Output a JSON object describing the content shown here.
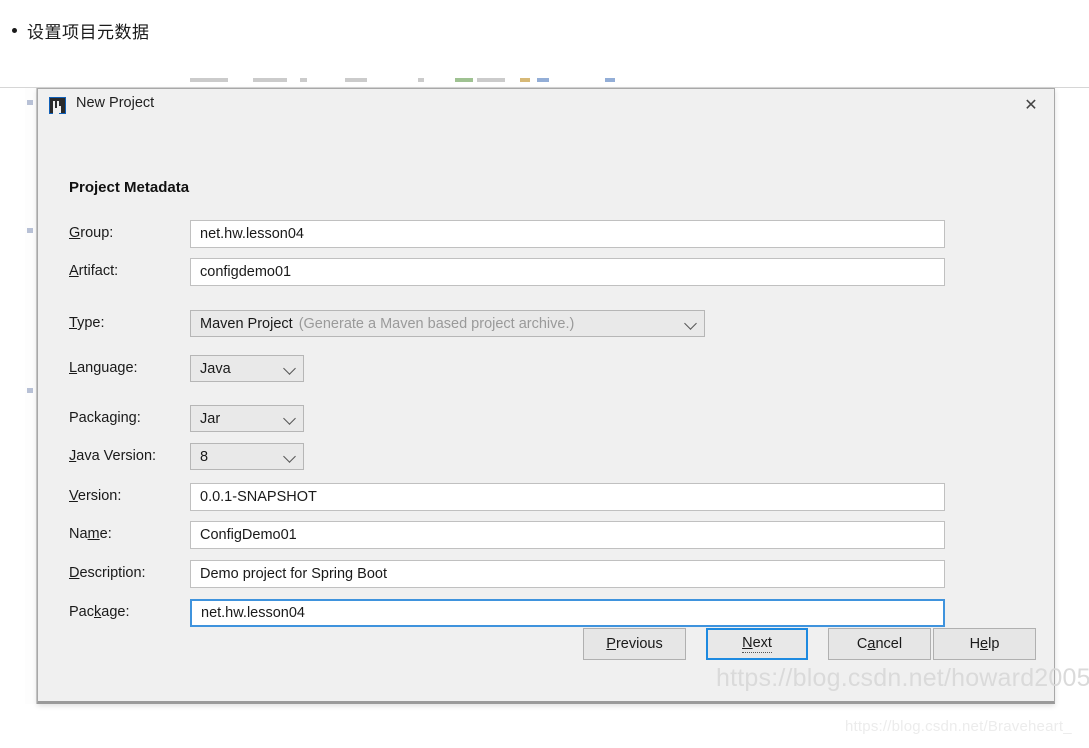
{
  "page": {
    "bullet_text": "设置项目元数据"
  },
  "dialog": {
    "title": "New Project",
    "icon": "intellij-idea-icon",
    "close_icon": "✕",
    "section_title": "Project Metadata"
  },
  "fields": {
    "group": {
      "label_pre": "",
      "label_mnemonic": "G",
      "label_post": "roup:",
      "value": "net.hw.lesson04",
      "type": "text"
    },
    "artifact": {
      "label_pre": "",
      "label_mnemonic": "A",
      "label_post": "rtifact:",
      "value": "configdemo01",
      "type": "text"
    },
    "type": {
      "label_pre": "",
      "label_mnemonic": "T",
      "label_post": "ype:",
      "value": "Maven Project",
      "hint": "(Generate a Maven based project archive.)",
      "type": "combo"
    },
    "language": {
      "label_pre": "",
      "label_mnemonic": "L",
      "label_post": "anguage:",
      "value": "Java",
      "type": "combo"
    },
    "packaging": {
      "label_pre": "Packa",
      "label_mnemonic": "g",
      "label_post": "ing:",
      "value": "Jar",
      "type": "combo"
    },
    "java_version": {
      "label_pre": "",
      "label_mnemonic": "J",
      "label_post": "ava Version:",
      "value": "8",
      "type": "combo"
    },
    "version": {
      "label_pre": "",
      "label_mnemonic": "V",
      "label_post": "ersion:",
      "value": "0.0.1-SNAPSHOT",
      "type": "text"
    },
    "name": {
      "label_pre": "Na",
      "label_mnemonic": "m",
      "label_post": "e:",
      "value": "ConfigDemo01",
      "type": "text"
    },
    "description": {
      "label_pre": "",
      "label_mnemonic": "D",
      "label_post": "escription:",
      "value": "Demo project for Spring Boot",
      "type": "text"
    },
    "package": {
      "label_pre": "Pac",
      "label_mnemonic": "k",
      "label_post": "age:",
      "value": "net.hw.lesson04",
      "type": "text",
      "focused": true
    }
  },
  "buttons": {
    "previous": {
      "pre": "",
      "mnemonic": "P",
      "post": "revious"
    },
    "next": {
      "pre": "",
      "mnemonic": "N",
      "post": "ext",
      "focused": true
    },
    "cancel": {
      "pre": "C",
      "mnemonic": "a",
      "post": "ncel"
    },
    "help": {
      "pre": "H",
      "mnemonic": "e",
      "post": "lp"
    }
  },
  "watermarks": {
    "top": "https://blog.csdn.net/howard2005",
    "bottom": "https://blog.csdn.net/Braveheart_"
  },
  "colors": {
    "dialog_bg": "#f0f0f0",
    "focus_blue": "#3f93dd",
    "button_focus_blue": "#1e8ae0",
    "hint_gray": "#9a9a9a",
    "watermark_gray": "#d9d9d9"
  }
}
